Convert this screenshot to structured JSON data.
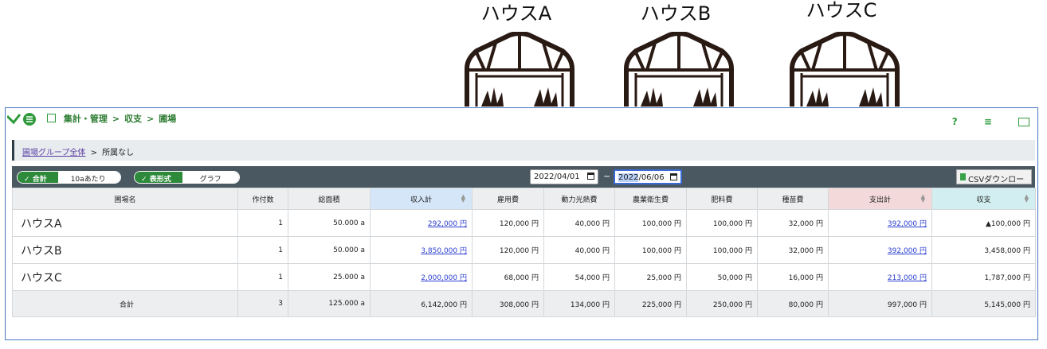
{
  "houses": [
    {
      "label": "ハウスA"
    },
    {
      "label": "ハウスB"
    },
    {
      "label": "ハウスC"
    }
  ],
  "topbar": {
    "breadcrumb": [
      "集計・管理",
      "収支",
      "圃場"
    ],
    "separator": ">",
    "help_icon": "?"
  },
  "crumb2": {
    "link": "圃場グループ全体",
    "sep": ">",
    "current": "所属なし"
  },
  "filter": {
    "sum_on": "合計",
    "sum_off": "10aあたり",
    "view_on": "表形式",
    "view_off": "グラフ",
    "date_from": "2022/04/01",
    "date_to_sel": "2022",
    "date_to_rest": "/06/06",
    "tilde": "~",
    "csv_label": "CSVダウンロード"
  },
  "table": {
    "headers": [
      "圃場名",
      "作付数",
      "総面積",
      "収入計",
      "雇用費",
      "動力光熱費",
      "農業衛生費",
      "肥料費",
      "種苗費",
      "支出計",
      "収支"
    ],
    "rows": [
      {
        "name": "ハウスA",
        "count": "1",
        "area": "50.000 a",
        "income": "292,000 円",
        "labor": "120,000 円",
        "power": "40,000 円",
        "hygiene": "100,000 円",
        "fert": "100,000 円",
        "seed": "32,000 円",
        "expense": "392,000 円",
        "balance": "▲100,000 円"
      },
      {
        "name": "ハウスB",
        "count": "1",
        "area": "50.000 a",
        "income": "3,850,000 円",
        "labor": "120,000 円",
        "power": "40,000 円",
        "hygiene": "100,000 円",
        "fert": "100,000 円",
        "seed": "32,000 円",
        "expense": "392,000 円",
        "balance": "3,458,000 円"
      },
      {
        "name": "ハウスC",
        "count": "1",
        "area": "25.000 a",
        "income": "2,000,000 円",
        "labor": "68,000 円",
        "power": "54,000 円",
        "hygiene": "25,000 円",
        "fert": "50,000 円",
        "seed": "16,000 円",
        "expense": "213,000 円",
        "balance": "1,787,000 円"
      }
    ],
    "total": {
      "name": "合計",
      "count": "3",
      "area": "125.000 a",
      "income": "6,142,000 円",
      "labor": "308,000 円",
      "power": "134,000 円",
      "hygiene": "225,000 円",
      "fert": "250,000 円",
      "seed": "80,000 円",
      "expense": "997,000 円",
      "balance": "5,145,000 円"
    }
  },
  "colors": {
    "brand_green": "#2e9a3a",
    "toolbar": "#4a5861",
    "link": "#2b3fd0"
  }
}
